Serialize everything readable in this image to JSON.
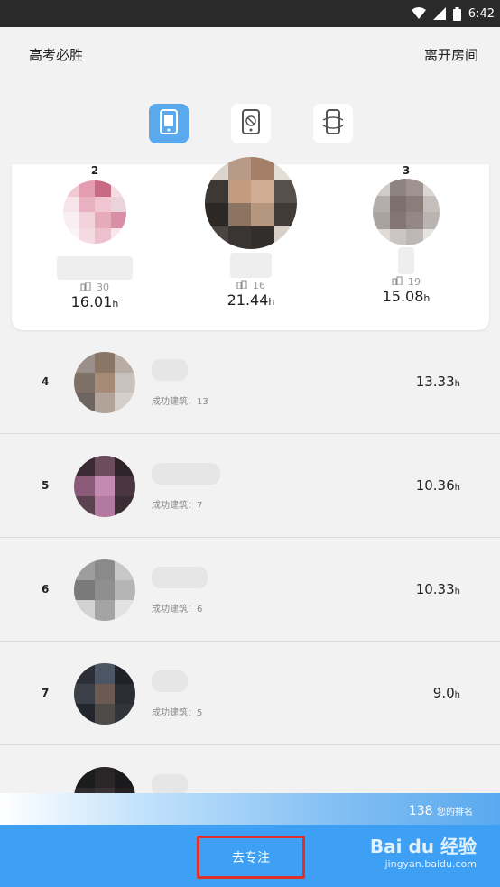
{
  "status_bar": {
    "time": "6:42"
  },
  "header": {
    "title": "高考必胜",
    "leave_label": "离开房间"
  },
  "mode_tabs": [
    {
      "icon": "phone-icon",
      "active": true
    },
    {
      "icon": "phone-forbidden-icon",
      "active": false
    },
    {
      "icon": "phone-rotate-icon",
      "active": false
    }
  ],
  "podium": [
    {
      "rank": "2",
      "buildings": "30",
      "hours": "16.01",
      "unit": "h"
    },
    {
      "rank": "",
      "buildings": "16",
      "hours": "21.44",
      "unit": "h"
    },
    {
      "rank": "3",
      "buildings": "19",
      "hours": "15.08",
      "unit": "h"
    }
  ],
  "list": [
    {
      "rank": "4",
      "built_label": "成功建筑：13",
      "hours": "13.33",
      "unit": "h"
    },
    {
      "rank": "5",
      "built_label": "成功建筑：7",
      "hours": "10.36",
      "unit": "h"
    },
    {
      "rank": "6",
      "built_label": "成功建筑：6",
      "hours": "10.33",
      "unit": "h"
    },
    {
      "rank": "7",
      "built_label": "成功建筑：5",
      "hours": "9.0",
      "unit": "h"
    }
  ],
  "my_rank": {
    "value": "138",
    "label": "您的排名"
  },
  "bottom": {
    "focus_label": "去专注",
    "watermark_logo": "Bai du 经验",
    "watermark_url": "jingyan.baidu.com"
  },
  "colors": {
    "accent": "#3ea0f5",
    "active_tab": "#5aa9ef",
    "highlight_border": "#e0302a"
  }
}
